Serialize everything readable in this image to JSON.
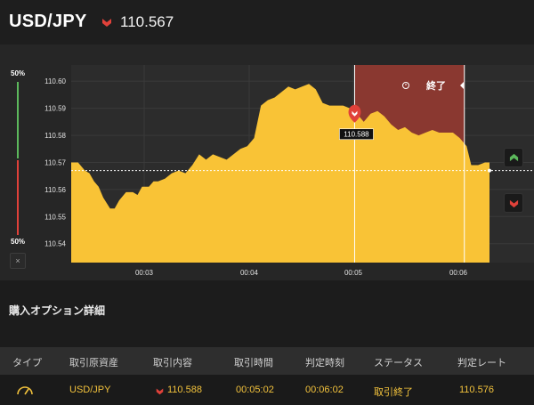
{
  "header": {
    "pair": "USD/JPY",
    "direction_icon": "down-arrow-icon",
    "price": "110.567",
    "colors": {
      "down": "#e0413a",
      "up": "#5cb85c"
    }
  },
  "gauge": {
    "top_label": "50%",
    "bottom_label": "50%",
    "close_label": "×"
  },
  "chart": {
    "y_ticks": [
      "110.60",
      "110.59",
      "110.58",
      "110.57",
      "110.56",
      "110.55",
      "110.54"
    ],
    "x_ticks": [
      "00:03",
      "00:04",
      "00:05",
      "00:06"
    ],
    "end_label": "終了",
    "end_icon": "history-icon",
    "entry_label": "110.588",
    "fill_color": "#f9c336",
    "end_zone_color": "#8a3830"
  },
  "chart_data": {
    "type": "area",
    "x_ticks": [
      "00:03",
      "00:04",
      "00:05",
      "00:06"
    ],
    "y_ticks": [
      110.54,
      110.55,
      110.56,
      110.57,
      110.58,
      110.59,
      110.6
    ],
    "ylim": [
      110.533,
      110.606
    ],
    "series": [
      {
        "points": [
          [
            0,
            110.57
          ],
          [
            3,
            110.57
          ],
          [
            6,
            110.567
          ],
          [
            8,
            110.566
          ],
          [
            10,
            110.563
          ],
          [
            12,
            110.561
          ],
          [
            14,
            110.557
          ],
          [
            17,
            110.553
          ],
          [
            19,
            110.553
          ],
          [
            21,
            110.556
          ],
          [
            24,
            110.559
          ],
          [
            27,
            110.559
          ],
          [
            29,
            110.558
          ],
          [
            31,
            110.561
          ],
          [
            34,
            110.561
          ],
          [
            36,
            110.563
          ],
          [
            38,
            110.563
          ],
          [
            41,
            110.564
          ],
          [
            44,
            110.566
          ],
          [
            47,
            110.567
          ],
          [
            50,
            110.566
          ],
          [
            53,
            110.569
          ],
          [
            56,
            110.573
          ],
          [
            59,
            110.571
          ],
          [
            62,
            110.573
          ],
          [
            65,
            110.572
          ],
          [
            68,
            110.571
          ],
          [
            71,
            110.573
          ],
          [
            74,
            110.575
          ],
          [
            77,
            110.576
          ],
          [
            80,
            110.579
          ],
          [
            83,
            110.591
          ],
          [
            86,
            110.593
          ],
          [
            89,
            110.594
          ],
          [
            92,
            110.596
          ],
          [
            95,
            110.598
          ],
          [
            98,
            110.597
          ],
          [
            101,
            110.598
          ],
          [
            104,
            110.599
          ],
          [
            107,
            110.597
          ],
          [
            110,
            110.592
          ],
          [
            113,
            110.591
          ],
          [
            116,
            110.591
          ],
          [
            119,
            110.591
          ],
          [
            122,
            110.59
          ],
          [
            125,
            110.588
          ],
          [
            128,
            110.585
          ],
          [
            131,
            110.588
          ],
          [
            134,
            110.589
          ],
          [
            137,
            110.587
          ],
          [
            140,
            110.584
          ],
          [
            143,
            110.582
          ],
          [
            146,
            110.583
          ],
          [
            149,
            110.581
          ],
          [
            152,
            110.58
          ],
          [
            155,
            110.581
          ],
          [
            158,
            110.582
          ],
          [
            161,
            110.581
          ],
          [
            164,
            110.581
          ],
          [
            167,
            110.581
          ],
          [
            170,
            110.579
          ],
          [
            173,
            110.576
          ],
          [
            175,
            110.569
          ],
          [
            178,
            110.569
          ],
          [
            181,
            110.57
          ],
          [
            183,
            110.57
          ]
        ]
      }
    ],
    "current_rate": 110.567,
    "entry_rate": 110.588,
    "entry_time_index": 124,
    "end_time_index": 172,
    "ylabel": "",
    "xlabel": "",
    "title": ""
  },
  "side_buttons": {
    "up_icon": "up-arrow-icon",
    "down_icon": "down-arrow-icon"
  },
  "details": {
    "title": "購入オプション詳細",
    "columns": [
      "タイプ",
      "取引原資産",
      "取引内容",
      "取引時間",
      "判定時刻",
      "ステータス",
      "判定レート"
    ],
    "row": {
      "type_icon": "gauge-icon",
      "asset": "USD/JPY",
      "direction_icon": "down-arrow-icon",
      "content": "110.588",
      "trade_time": "00:05:02",
      "judge_time": "00:06:02",
      "status": "取引終了",
      "rate": "110.576"
    }
  }
}
